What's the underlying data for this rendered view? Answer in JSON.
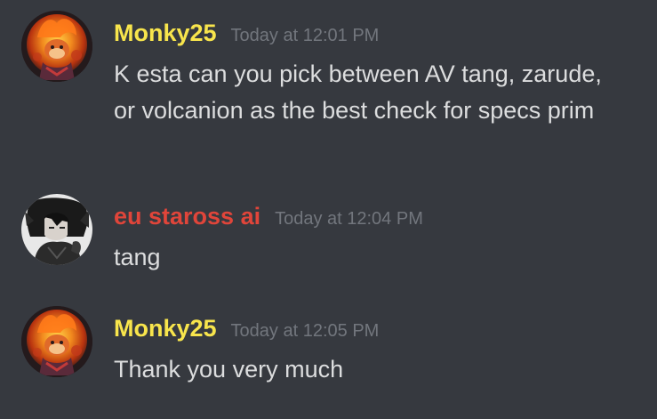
{
  "colors": {
    "background": "#36393f",
    "monky_name": "#f8e54c",
    "staross_name": "#e0453a",
    "timestamp": "#72767d",
    "text": "#dcddde"
  },
  "messages": [
    {
      "username": "Monky25",
      "timestamp": "Today at 12:01 PM",
      "text": "K esta can you pick between AV tang, zarude, or volcanion as the best check for specs prim",
      "avatar_icon": "fire-monkey-avatar"
    },
    {
      "username": "eu staross ai",
      "timestamp": "Today at 12:04 PM",
      "text": "tang",
      "avatar_icon": "anime-character-avatar"
    },
    {
      "username": "Monky25",
      "timestamp": "Today at 12:05 PM",
      "text": "Thank you very much",
      "avatar_icon": "fire-monkey-avatar"
    }
  ]
}
